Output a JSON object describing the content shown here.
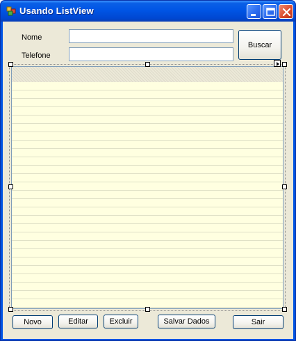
{
  "window": {
    "title": "Usando ListView",
    "icon": "app-icon",
    "controls": [
      "minimize-icon",
      "maximize-icon",
      "close-icon"
    ]
  },
  "form": {
    "nome_label": "Nome",
    "nome_value": "",
    "telefone_label": "Telefone",
    "telefone_value": "",
    "buscar_label": "Buscar"
  },
  "listview": {
    "items": []
  },
  "buttons": {
    "novo": "Novo",
    "editar": "Editar",
    "excluir": "Excluir",
    "salvar": "Salvar Dados",
    "sair": "Sair"
  },
  "colors": {
    "titlebar": "#0055e5",
    "client": "#ece9d8",
    "listview_background": "#ffffe0"
  }
}
